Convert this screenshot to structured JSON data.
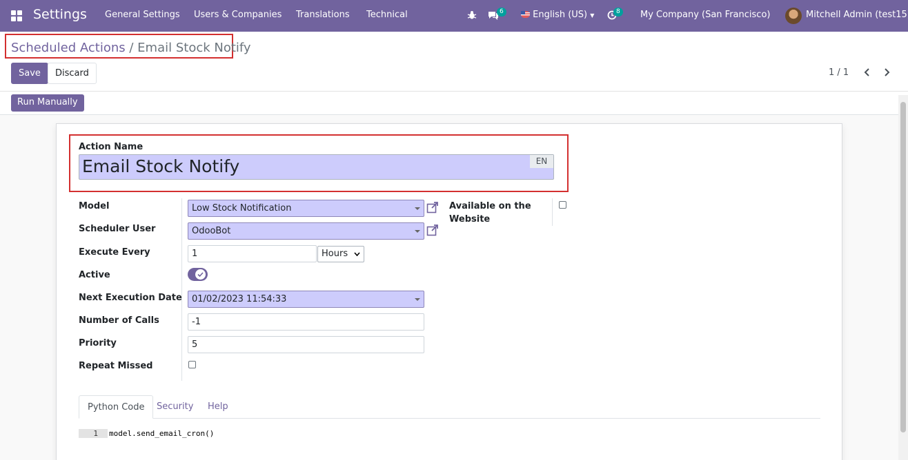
{
  "navbar": {
    "app_title": "Settings",
    "menu": [
      "General Settings",
      "Users & Companies",
      "Translations",
      "Technical"
    ],
    "discuss_count": "6",
    "language": "English (US)",
    "activity_count": "8",
    "company": "My Company (San Francisco)",
    "user": "Mitchell Admin (test15)"
  },
  "breadcrumb": {
    "parent": "Scheduled Actions",
    "separator": "/",
    "current": "Email Stock Notify"
  },
  "control": {
    "save_label": "Save",
    "discard_label": "Discard",
    "pager": "1 / 1"
  },
  "statusbar": {
    "run_label": "Run Manually"
  },
  "form": {
    "action_name_label": "Action Name",
    "action_name": "Email Stock Notify",
    "lang": "EN",
    "model_label": "Model",
    "model": "Low Stock Notification",
    "scheduler_user_label": "Scheduler User",
    "scheduler_user": "OdooBot",
    "execute_every_label": "Execute Every",
    "execute_every": "1",
    "interval_unit": "Hours",
    "active_label": "Active",
    "active": true,
    "next_exec_label": "Next Execution Date",
    "next_exec": "01/02/2023 11:54:33",
    "num_calls_label": "Number of Calls",
    "num_calls": "-1",
    "priority_label": "Priority",
    "priority": "5",
    "repeat_missed_label": "Repeat Missed",
    "repeat_missed": false,
    "website_label_1": "Available on the",
    "website_label_2": "Website",
    "website": false
  },
  "tabs": [
    "Python Code",
    "Security",
    "Help"
  ],
  "code": {
    "line_no": "1",
    "text": "model.send_email_cron()"
  },
  "colors": {
    "brand": "#71639e",
    "badge": "#00a09d",
    "highlight_field": "#cdccfc",
    "annotation_red": "#d32f2f"
  },
  "icons": {
    "apps": "apps-grid-icon",
    "debug": "bug-icon",
    "discuss": "chat-icon",
    "flag": "us-flag-icon",
    "activity": "clock-icon",
    "external": "external-link-icon",
    "prev": "chevron-left-icon",
    "next": "chevron-right-icon"
  }
}
